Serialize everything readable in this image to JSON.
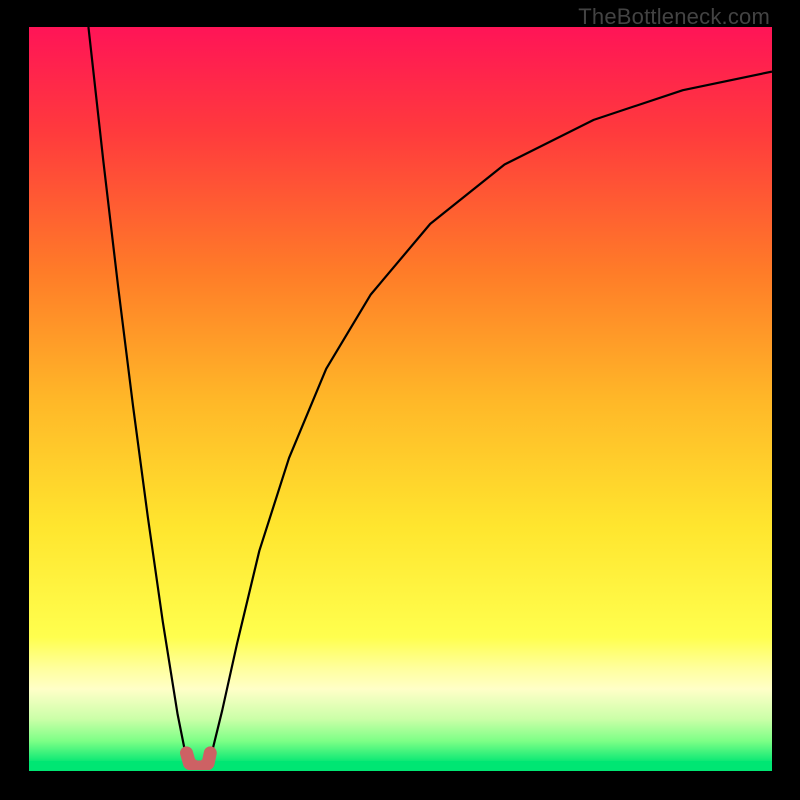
{
  "watermark": "TheBottleneck.com",
  "chart_data": {
    "type": "line",
    "title": "",
    "xlabel": "",
    "ylabel": "",
    "xlim": [
      0,
      100
    ],
    "ylim": [
      0,
      100
    ],
    "grid": false,
    "legend": false,
    "gradient_stops": [
      {
        "pct": 0,
        "color": "#ff1457"
      },
      {
        "pct": 14,
        "color": "#ff3a3d"
      },
      {
        "pct": 33,
        "color": "#ff7c28"
      },
      {
        "pct": 50,
        "color": "#ffb728"
      },
      {
        "pct": 67,
        "color": "#ffe52e"
      },
      {
        "pct": 82,
        "color": "#ffff4e"
      },
      {
        "pct": 86,
        "color": "#ffff9a"
      },
      {
        "pct": 89,
        "color": "#ffffc8"
      },
      {
        "pct": 93,
        "color": "#cbffa8"
      },
      {
        "pct": 96,
        "color": "#7cff86"
      },
      {
        "pct": 99,
        "color": "#00e673"
      },
      {
        "pct": 100,
        "color": "#00e673"
      }
    ],
    "footer_band": {
      "height_pct": 1.3,
      "color": "#00e673"
    },
    "series": [
      {
        "name": "left-branch",
        "stroke": "#000000",
        "width": 2.2,
        "x": [
          8.0,
          10.0,
          12.0,
          14.0,
          16.0,
          18.0,
          20.0,
          21.2
        ],
        "y": [
          100.0,
          82.0,
          65.0,
          49.0,
          34.0,
          20.0,
          7.5,
          1.5
        ]
      },
      {
        "name": "right-branch",
        "stroke": "#000000",
        "width": 2.2,
        "x": [
          24.4,
          26.0,
          28.0,
          31.0,
          35.0,
          40.0,
          46.0,
          54.0,
          64.0,
          76.0,
          88.0,
          100.0
        ],
        "y": [
          1.5,
          8.0,
          17.0,
          29.5,
          42.0,
          54.0,
          64.0,
          73.5,
          81.5,
          87.5,
          91.5,
          94.0
        ]
      },
      {
        "name": "valley-marker",
        "stroke": "#cd6164",
        "width": 13,
        "linecap": "round",
        "x": [
          21.2,
          21.6,
          22.4,
          23.4,
          24.1,
          24.4
        ],
        "y": [
          2.3,
          0.9,
          0.4,
          0.4,
          0.9,
          2.3
        ]
      }
    ]
  }
}
